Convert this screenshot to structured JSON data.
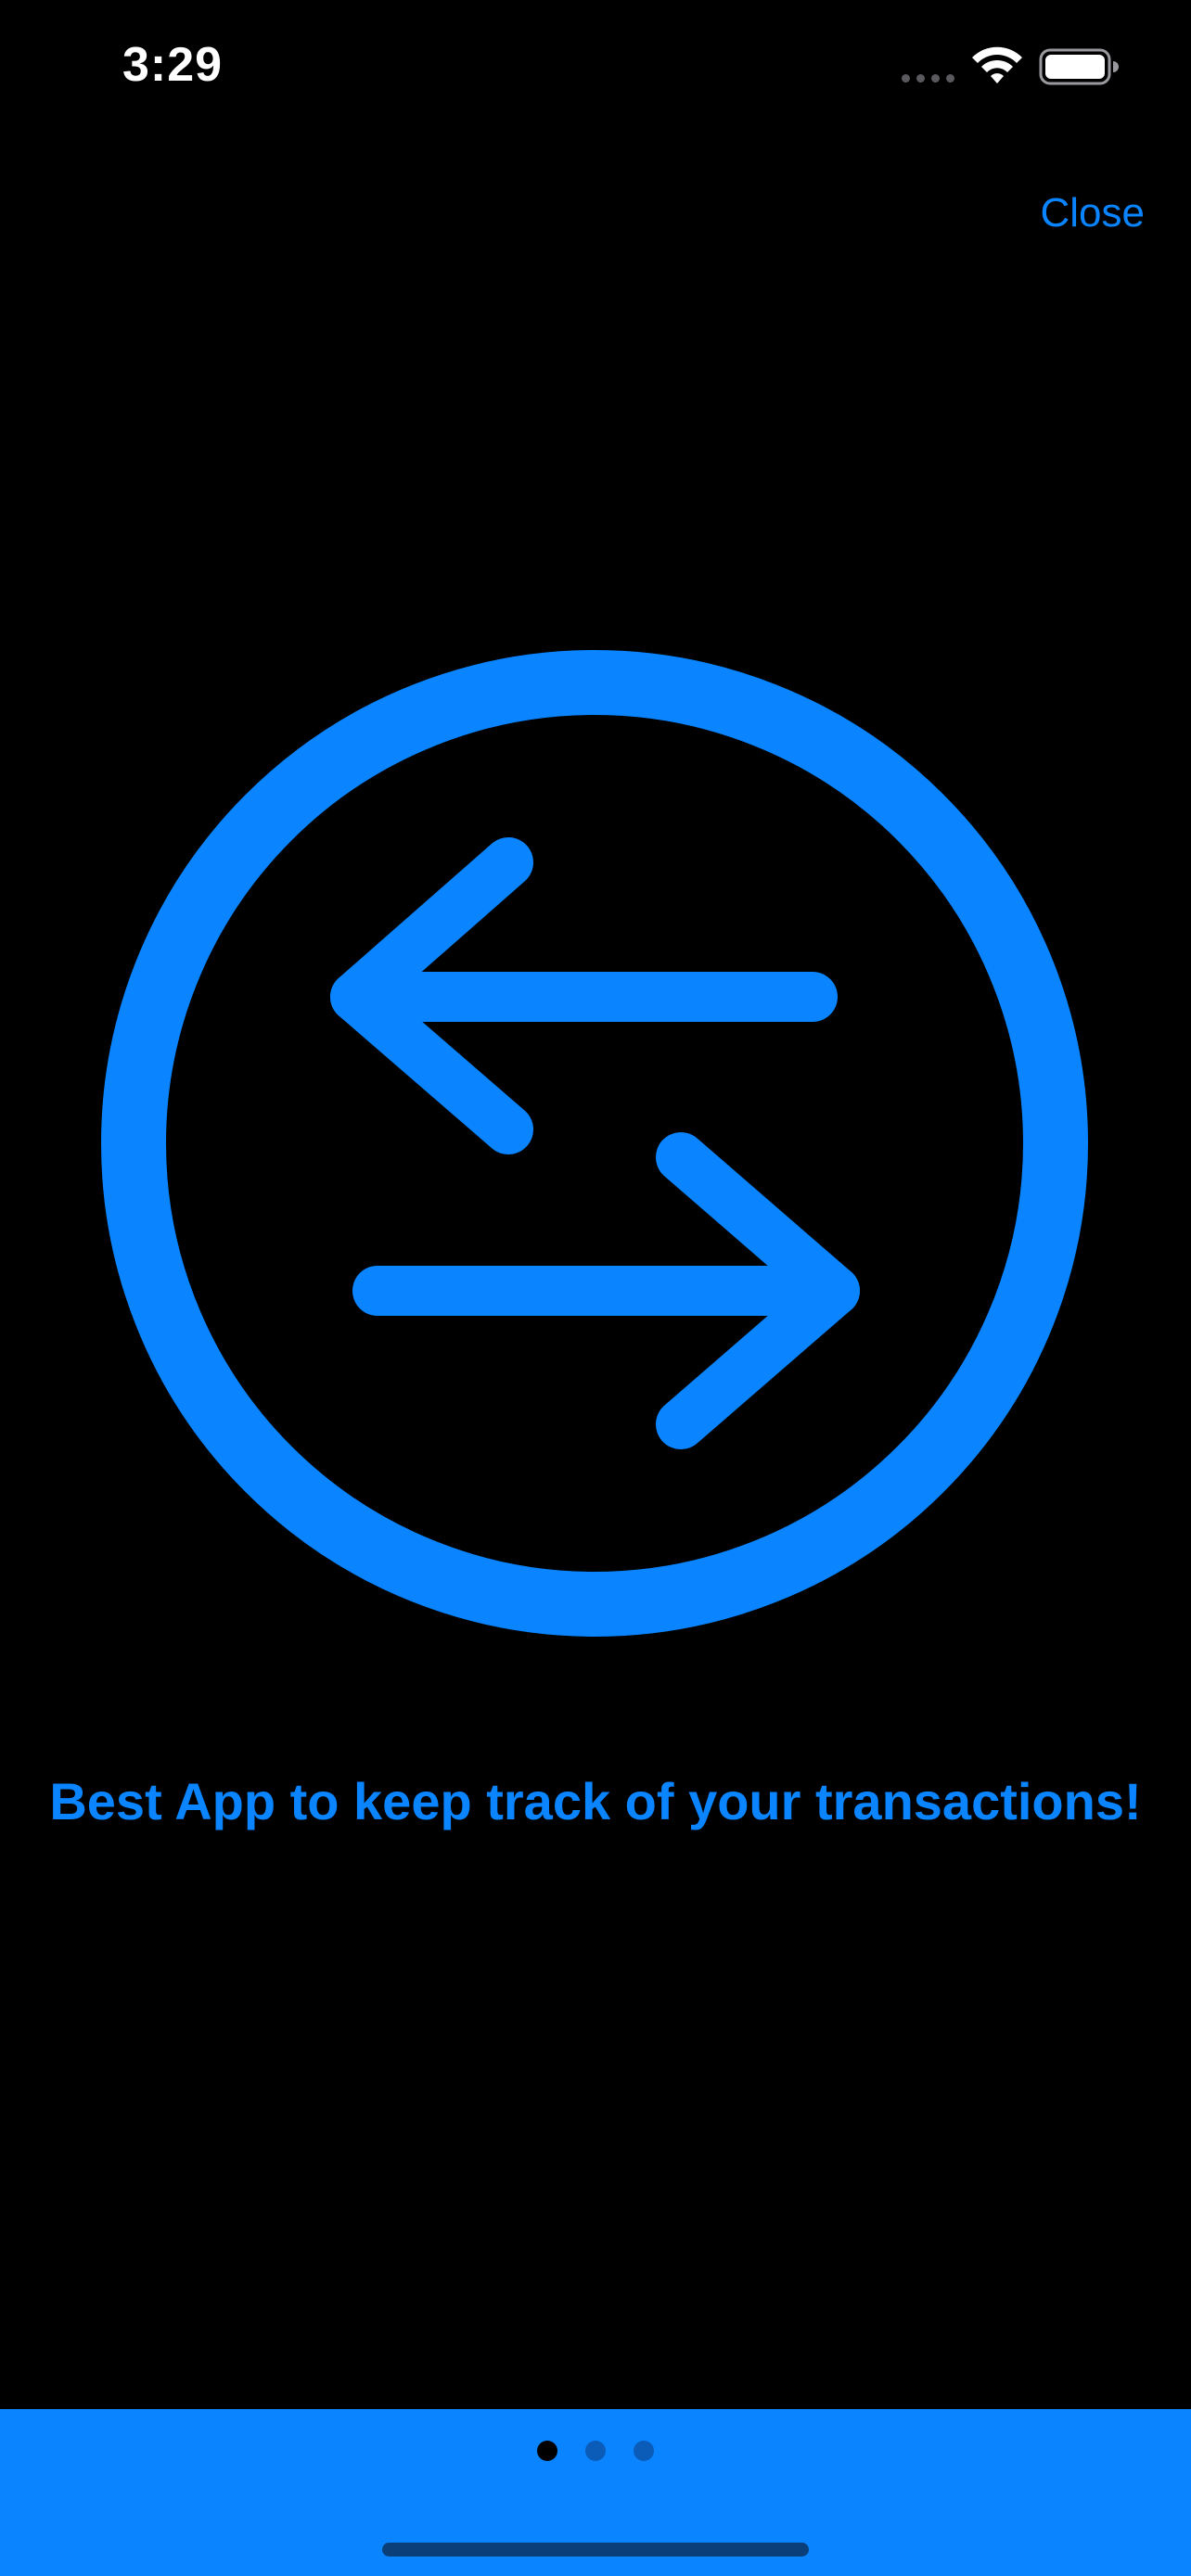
{
  "status_bar": {
    "time": "3:29"
  },
  "header": {
    "close_label": "Close"
  },
  "hero": {
    "icon": "arrow-left-arrow-right-circle-icon",
    "headline": "Best App to keep track of your transactions!"
  },
  "pager": {
    "page_count": 3,
    "current_page": 1
  },
  "colors": {
    "accent": "#0a84ff",
    "background": "#000000"
  }
}
